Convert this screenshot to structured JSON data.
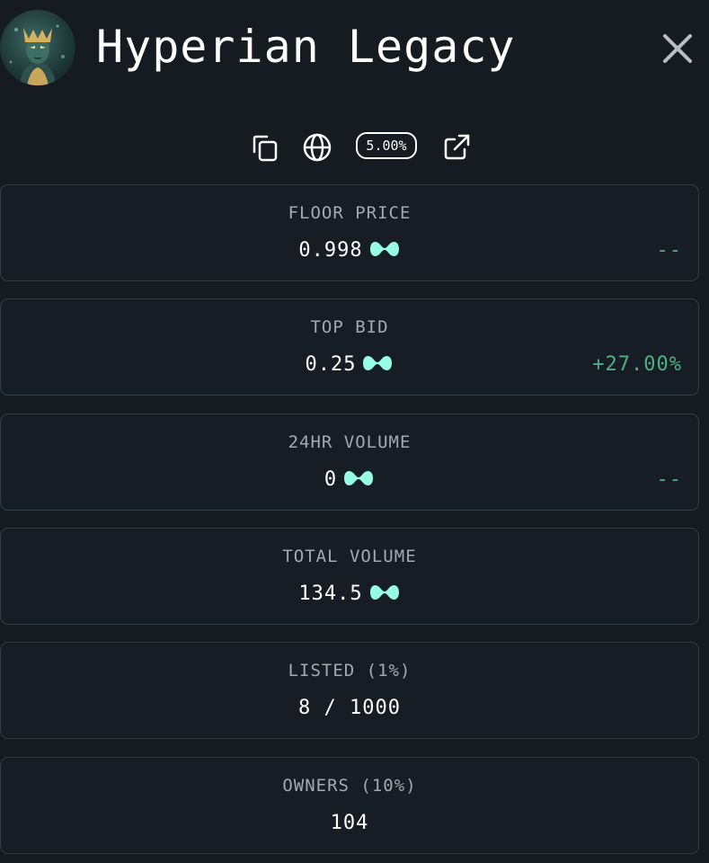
{
  "header": {
    "title": "Hyperian Legacy"
  },
  "toolbar": {
    "copy_icon": "copy-icon",
    "globe_icon": "globe-icon",
    "royalty": "5.00%",
    "external_icon": "external-link-icon"
  },
  "stats": [
    {
      "label": "FLOOR PRICE",
      "value": "0.998",
      "currency": true,
      "change": "--"
    },
    {
      "label": "TOP BID",
      "value": "0.25",
      "currency": true,
      "change": "+27.00%"
    },
    {
      "label": "24HR VOLUME",
      "value": "0",
      "currency": true,
      "change": "--"
    },
    {
      "label": "TOTAL VOLUME",
      "value": "134.5",
      "currency": true,
      "change": ""
    },
    {
      "label": "LISTED (1%)",
      "value": "8 / 1000",
      "currency": false,
      "change": ""
    },
    {
      "label": "OWNERS (10%)",
      "value": "104",
      "currency": false,
      "change": ""
    }
  ],
  "colors": {
    "background": "#151b21",
    "card_border": "#353c44",
    "label": "#a3a9b1",
    "positive": "#4fae83",
    "currency_icon": "#97fce4"
  }
}
